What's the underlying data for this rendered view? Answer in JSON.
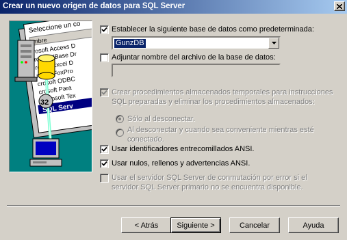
{
  "window": {
    "title": "Crear un nuevo origen de datos para SQL Server",
    "close_glyph": "X"
  },
  "illustration": {
    "header": "Seleccione un co",
    "column": "mbre",
    "items": [
      "rosoft Access D",
      "rosoft dBase Dr",
      "rosoft Excel D",
      "rosoft FoxPro",
      "crosoft ODBC",
      "crosoft Para",
      "Microsoft Tex",
      "SQL Serv"
    ],
    "badge": "32"
  },
  "options": {
    "default_db": {
      "label": "Establecer la siguiente base de datos como predeterminada:",
      "checked": true
    },
    "db_select": {
      "value": "GunzDB"
    },
    "attach_file": {
      "label": "Adjuntar nombre del archivo de la base de datos:",
      "checked": false
    },
    "filename_input": {
      "value": ""
    },
    "temp_procs": {
      "label": "Crear procedimientos almacenados temporales para instrucciones SQL preparadas y eliminar los procedimientos almacenados:",
      "checked": true,
      "enabled": false
    },
    "radio_disconnect": {
      "label": "Sólo al desconectar.",
      "selected": true
    },
    "radio_when_appropriate": {
      "label": "Al desconectar y cuando sea conveniente mientras esté conectado.",
      "selected": false
    },
    "quoted_ids": {
      "label": "Usar identificadores entrecomillados ANSI.",
      "checked": true
    },
    "ansi_nulls": {
      "label": "Usar nulos, rellenos y advertencias ANSI.",
      "checked": true
    },
    "failover": {
      "label": "Usar el servidor SQL Server de conmutación por error si el servidor SQL Server primario no se encuentra disponible.",
      "checked": false,
      "enabled": false
    }
  },
  "buttons": {
    "back": "< Atrás",
    "next": "Siguiente >",
    "cancel": "Cancelar",
    "help": "Ayuda"
  },
  "colors": {
    "titlebar_start": "#0a246a",
    "titlebar_end": "#a6caf0",
    "dialog_bg": "#d4d0c8",
    "illus_bg": "#008080"
  }
}
